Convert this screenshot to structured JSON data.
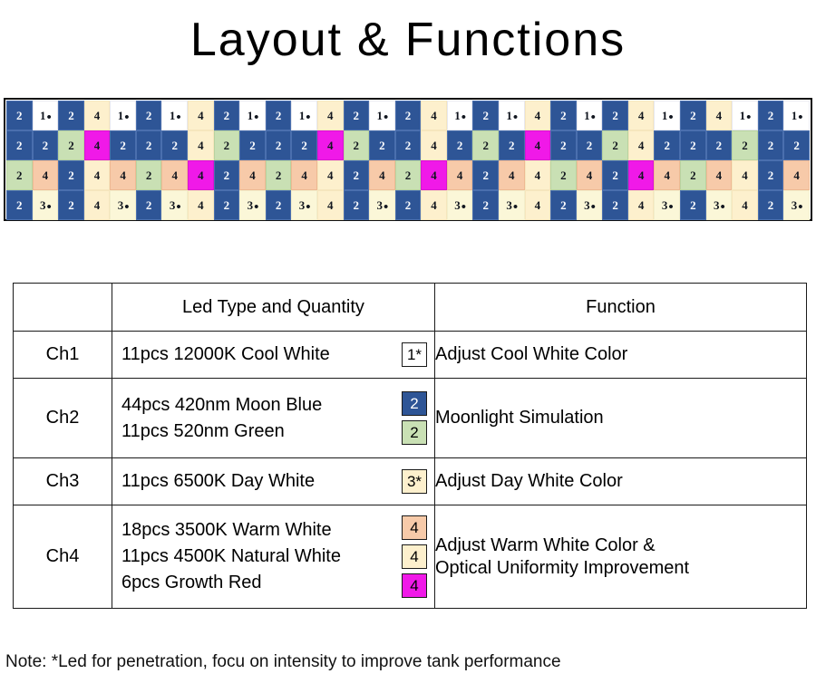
{
  "title": {
    "left": "Layout",
    "amp": "&",
    "right": "Functions"
  },
  "led_legend": {
    "blue": "#2e5596",
    "white": "#ffffff",
    "cream": "#fdf0cd",
    "cream2": "#fbf7d8",
    "green": "#c9e0b4",
    "peach": "#f7caa9",
    "magenta": "#f019e8"
  },
  "led_grid": {
    "columns": 30,
    "rows": 4,
    "cells": [
      [
        {
          "label": "2",
          "star": false,
          "color": "blue"
        },
        {
          "label": "1",
          "star": true,
          "color": "white"
        },
        {
          "label": "2",
          "star": false,
          "color": "blue"
        },
        {
          "label": "4",
          "star": false,
          "color": "cream"
        },
        {
          "label": "1",
          "star": true,
          "color": "white"
        },
        {
          "label": "2",
          "star": false,
          "color": "blue"
        },
        {
          "label": "1",
          "star": true,
          "color": "white"
        },
        {
          "label": "4",
          "star": false,
          "color": "cream"
        },
        {
          "label": "2",
          "star": false,
          "color": "blue"
        },
        {
          "label": "1",
          "star": true,
          "color": "white"
        },
        {
          "label": "2",
          "star": false,
          "color": "blue"
        },
        {
          "label": "1",
          "star": true,
          "color": "white"
        },
        {
          "label": "4",
          "star": false,
          "color": "cream"
        },
        {
          "label": "2",
          "star": false,
          "color": "blue"
        },
        {
          "label": "1",
          "star": true,
          "color": "white"
        },
        {
          "label": "2",
          "star": false,
          "color": "blue"
        },
        {
          "label": "4",
          "star": false,
          "color": "cream"
        },
        {
          "label": "1",
          "star": true,
          "color": "white"
        },
        {
          "label": "2",
          "star": false,
          "color": "blue"
        },
        {
          "label": "1",
          "star": true,
          "color": "white"
        },
        {
          "label": "4",
          "star": false,
          "color": "cream"
        },
        {
          "label": "2",
          "star": false,
          "color": "blue"
        },
        {
          "label": "1",
          "star": true,
          "color": "white"
        },
        {
          "label": "2",
          "star": false,
          "color": "blue"
        },
        {
          "label": "4",
          "star": false,
          "color": "cream"
        },
        {
          "label": "1",
          "star": true,
          "color": "white"
        },
        {
          "label": "2",
          "star": false,
          "color": "blue"
        },
        {
          "label": "4",
          "star": false,
          "color": "cream"
        },
        {
          "label": "1",
          "star": true,
          "color": "white"
        },
        {
          "label": "2",
          "star": false,
          "color": "blue"
        },
        {
          "label": "1",
          "star": true,
          "color": "white"
        }
      ],
      [
        {
          "label": "2",
          "star": false,
          "color": "blue"
        },
        {
          "label": "2",
          "star": false,
          "color": "blue"
        },
        {
          "label": "2",
          "star": false,
          "color": "green"
        },
        {
          "label": "4",
          "star": false,
          "color": "magenta"
        },
        {
          "label": "2",
          "star": false,
          "color": "blue"
        },
        {
          "label": "2",
          "star": false,
          "color": "blue"
        },
        {
          "label": "2",
          "star": false,
          "color": "blue"
        },
        {
          "label": "4",
          "star": false,
          "color": "cream"
        },
        {
          "label": "2",
          "star": false,
          "color": "green"
        },
        {
          "label": "2",
          "star": false,
          "color": "blue"
        },
        {
          "label": "2",
          "star": false,
          "color": "blue"
        },
        {
          "label": "2",
          "star": false,
          "color": "blue"
        },
        {
          "label": "4",
          "star": false,
          "color": "magenta"
        },
        {
          "label": "2",
          "star": false,
          "color": "green"
        },
        {
          "label": "2",
          "star": false,
          "color": "blue"
        },
        {
          "label": "2",
          "star": false,
          "color": "blue"
        },
        {
          "label": "4",
          "star": false,
          "color": "cream"
        },
        {
          "label": "2",
          "star": false,
          "color": "blue"
        },
        {
          "label": "2",
          "star": false,
          "color": "green"
        },
        {
          "label": "2",
          "star": false,
          "color": "blue"
        },
        {
          "label": "4",
          "star": false,
          "color": "magenta"
        },
        {
          "label": "2",
          "star": false,
          "color": "blue"
        },
        {
          "label": "2",
          "star": false,
          "color": "blue"
        },
        {
          "label": "2",
          "star": false,
          "color": "green"
        },
        {
          "label": "4",
          "star": false,
          "color": "cream"
        },
        {
          "label": "2",
          "star": false,
          "color": "blue"
        },
        {
          "label": "2",
          "star": false,
          "color": "blue"
        },
        {
          "label": "2",
          "star": false,
          "color": "blue"
        },
        {
          "label": "2",
          "star": false,
          "color": "green"
        },
        {
          "label": "2",
          "star": false,
          "color": "blue"
        },
        {
          "label": "2",
          "star": false,
          "color": "blue"
        }
      ],
      [
        {
          "label": "2",
          "star": false,
          "color": "green"
        },
        {
          "label": "4",
          "star": false,
          "color": "peach"
        },
        {
          "label": "2",
          "star": false,
          "color": "blue"
        },
        {
          "label": "4",
          "star": false,
          "color": "cream"
        },
        {
          "label": "4",
          "star": false,
          "color": "peach"
        },
        {
          "label": "2",
          "star": false,
          "color": "green"
        },
        {
          "label": "4",
          "star": false,
          "color": "peach"
        },
        {
          "label": "4",
          "star": false,
          "color": "magenta"
        },
        {
          "label": "2",
          "star": false,
          "color": "blue"
        },
        {
          "label": "4",
          "star": false,
          "color": "peach"
        },
        {
          "label": "2",
          "star": false,
          "color": "green"
        },
        {
          "label": "4",
          "star": false,
          "color": "peach"
        },
        {
          "label": "4",
          "star": false,
          "color": "cream"
        },
        {
          "label": "2",
          "star": false,
          "color": "blue"
        },
        {
          "label": "4",
          "star": false,
          "color": "peach"
        },
        {
          "label": "2",
          "star": false,
          "color": "green"
        },
        {
          "label": "4",
          "star": false,
          "color": "magenta"
        },
        {
          "label": "4",
          "star": false,
          "color": "peach"
        },
        {
          "label": "2",
          "star": false,
          "color": "blue"
        },
        {
          "label": "4",
          "star": false,
          "color": "peach"
        },
        {
          "label": "4",
          "star": false,
          "color": "cream"
        },
        {
          "label": "2",
          "star": false,
          "color": "green"
        },
        {
          "label": "4",
          "star": false,
          "color": "peach"
        },
        {
          "label": "2",
          "star": false,
          "color": "blue"
        },
        {
          "label": "4",
          "star": false,
          "color": "magenta"
        },
        {
          "label": "4",
          "star": false,
          "color": "peach"
        },
        {
          "label": "2",
          "star": false,
          "color": "green"
        },
        {
          "label": "4",
          "star": false,
          "color": "peach"
        },
        {
          "label": "4",
          "star": false,
          "color": "cream"
        },
        {
          "label": "2",
          "star": false,
          "color": "blue"
        },
        {
          "label": "4",
          "star": false,
          "color": "peach"
        }
      ],
      [
        {
          "label": "2",
          "star": false,
          "color": "blue"
        },
        {
          "label": "3",
          "star": true,
          "color": "cream2"
        },
        {
          "label": "2",
          "star": false,
          "color": "blue"
        },
        {
          "label": "4",
          "star": false,
          "color": "cream"
        },
        {
          "label": "3",
          "star": true,
          "color": "cream2"
        },
        {
          "label": "2",
          "star": false,
          "color": "blue"
        },
        {
          "label": "3",
          "star": true,
          "color": "cream2"
        },
        {
          "label": "4",
          "star": false,
          "color": "cream"
        },
        {
          "label": "2",
          "star": false,
          "color": "blue"
        },
        {
          "label": "3",
          "star": true,
          "color": "cream2"
        },
        {
          "label": "2",
          "star": false,
          "color": "blue"
        },
        {
          "label": "3",
          "star": true,
          "color": "cream2"
        },
        {
          "label": "4",
          "star": false,
          "color": "cream"
        },
        {
          "label": "2",
          "star": false,
          "color": "blue"
        },
        {
          "label": "3",
          "star": true,
          "color": "cream2"
        },
        {
          "label": "2",
          "star": false,
          "color": "blue"
        },
        {
          "label": "4",
          "star": false,
          "color": "cream"
        },
        {
          "label": "3",
          "star": true,
          "color": "cream2"
        },
        {
          "label": "2",
          "star": false,
          "color": "blue"
        },
        {
          "label": "3",
          "star": true,
          "color": "cream2"
        },
        {
          "label": "4",
          "star": false,
          "color": "cream"
        },
        {
          "label": "2",
          "star": false,
          "color": "blue"
        },
        {
          "label": "3",
          "star": true,
          "color": "cream2"
        },
        {
          "label": "2",
          "star": false,
          "color": "blue"
        },
        {
          "label": "4",
          "star": false,
          "color": "cream"
        },
        {
          "label": "3",
          "star": true,
          "color": "cream2"
        },
        {
          "label": "2",
          "star": false,
          "color": "blue"
        },
        {
          "label": "3",
          "star": true,
          "color": "cream2"
        },
        {
          "label": "4",
          "star": false,
          "color": "cream"
        },
        {
          "label": "2",
          "star": false,
          "color": "blue"
        },
        {
          "label": "3",
          "star": true,
          "color": "cream2"
        }
      ]
    ]
  },
  "table": {
    "headers": {
      "channel": "",
      "type": "Led Type and Quantity",
      "function": "Function"
    },
    "rows": [
      {
        "channel": "Ch1",
        "types": [
          "11pcs 12000K Cool White"
        ],
        "badges": [
          {
            "label": "1*",
            "color": "white"
          }
        ],
        "function": "Adjust Cool White Color"
      },
      {
        "channel": "Ch2",
        "types": [
          "44pcs 420nm Moon Blue",
          "11pcs 520nm Green"
        ],
        "badges": [
          {
            "label": "2",
            "color": "blue"
          },
          {
            "label": "2",
            "color": "green"
          }
        ],
        "function": "Moonlight Simulation"
      },
      {
        "channel": "Ch3",
        "types": [
          "11pcs 6500K Day White"
        ],
        "badges": [
          {
            "label": "3*",
            "color": "cream"
          }
        ],
        "function": "Adjust Day White Color"
      },
      {
        "channel": "Ch4",
        "types": [
          "18pcs 3500K Warm White",
          "11pcs 4500K Natural White",
          "6pcs Growth Red"
        ],
        "badges": [
          {
            "label": "4",
            "color": "peach"
          },
          {
            "label": "4",
            "color": "cream"
          },
          {
            "label": "4",
            "color": "magenta"
          }
        ],
        "function_line1": "Adjust Warm White Color &",
        "function_line2": "Optical Uniformity Improvement"
      }
    ]
  },
  "note": "Note: *Led for penetration, focu on intensity to improve tank performance"
}
